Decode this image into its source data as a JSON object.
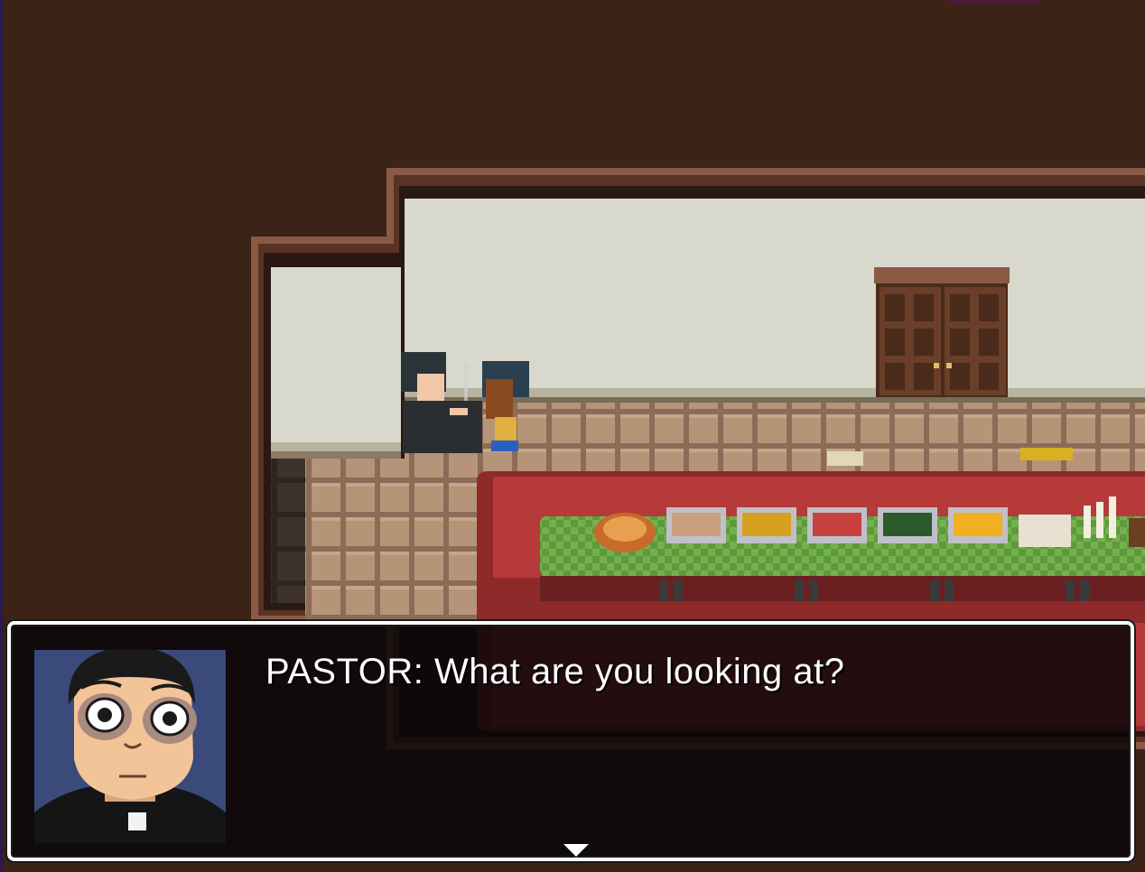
{
  "dialogue": {
    "speaker": "PASTOR",
    "line": "PASTOR: What are you looking at?"
  },
  "portrait": {
    "character": "pastor",
    "icon": "pastor-portrait"
  },
  "indicators": {
    "continue_icon": "triangle-down-icon"
  },
  "colors": {
    "background": "#3b2318",
    "wall": "#d9d8cc",
    "floor": "#b28c74",
    "tablecloth": "#b63a3a",
    "table_top": "#5c9a3c",
    "dialog_border": "#ffffff"
  }
}
